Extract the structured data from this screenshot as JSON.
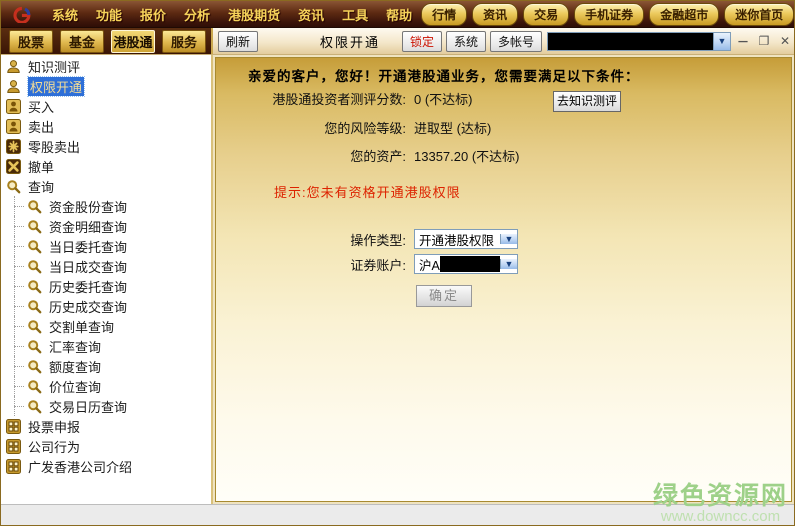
{
  "menubar": {
    "items": [
      "系统",
      "功能",
      "报价",
      "分析",
      "港股期货",
      "资讯",
      "工具",
      "帮助"
    ],
    "quick_links": [
      "行情",
      "资讯",
      "交易",
      "手机证券",
      "金融超市",
      "迷你首页"
    ],
    "controls": {
      "minimize": "－",
      "restore": "❐",
      "close": "✕"
    }
  },
  "tabs": {
    "items": [
      "股票",
      "基金",
      "港股通",
      "服务"
    ],
    "active": "港股通"
  },
  "toolbar": {
    "refresh": "刷新",
    "title": "权限开通",
    "lock": "锁定",
    "system": "系统",
    "multi_account": "多帐号",
    "account_combo_icon": "chevron-down-icon",
    "window_controls": {
      "minimize": "－",
      "restore": "❐",
      "close": "✕"
    }
  },
  "sidebar": {
    "items": [
      {
        "label": "知识测评",
        "icon": "person-icon"
      },
      {
        "label": "权限开通",
        "icon": "person-icon",
        "selected": true
      },
      {
        "label": "买入",
        "icon": "person-badge-icon"
      },
      {
        "label": "卖出",
        "icon": "person-badge-icon"
      },
      {
        "label": "零股卖出",
        "icon": "asterisk-icon"
      },
      {
        "label": "撤单",
        "icon": "x-mark-icon"
      },
      {
        "label": "查询",
        "icon": "magnifier-icon"
      },
      {
        "label": "资金股份查询",
        "icon": "magnifier-icon"
      },
      {
        "label": "资金明细查询",
        "icon": "magnifier-icon"
      },
      {
        "label": "当日委托查询",
        "icon": "magnifier-icon"
      },
      {
        "label": "当日成交查询",
        "icon": "magnifier-icon"
      },
      {
        "label": "历史委托查询",
        "icon": "magnifier-icon"
      },
      {
        "label": "历史成交查询",
        "icon": "magnifier-icon"
      },
      {
        "label": "交割单查询",
        "icon": "magnifier-icon"
      },
      {
        "label": "汇率查询",
        "icon": "magnifier-icon"
      },
      {
        "label": "额度查询",
        "icon": "magnifier-icon"
      },
      {
        "label": "价位查询",
        "icon": "magnifier-icon"
      },
      {
        "label": "交易日历查询",
        "icon": "magnifier-icon"
      },
      {
        "label": "投票申报",
        "icon": "grid-icon"
      },
      {
        "label": "公司行为",
        "icon": "grid-icon"
      },
      {
        "label": "广发香港公司介绍",
        "icon": "grid-icon"
      }
    ]
  },
  "main": {
    "greeting": "亲爱的客户，您好！开通港股通业务，您需要满足以下条件：",
    "conditions": [
      {
        "label": "港股通投资者测评分数:",
        "value": "0 (不达标)"
      },
      {
        "label": "您的风险等级:",
        "value": "进取型 (达标)"
      },
      {
        "label": "您的资产:",
        "value": "13357.20 (不达标)"
      }
    ],
    "quiz_button": "去知识测评",
    "tip": "提示:您未有资格开通港股权限",
    "form": {
      "operation_label": "操作类型:",
      "operation_value": "开通港股权限",
      "account_label": "证券账户:",
      "account_prefix": "沪A",
      "submit_label": "确定"
    }
  },
  "watermark": {
    "name": "绿色资源网",
    "url": "www.downcc.com"
  },
  "colors": {
    "accent_gold": "#d4a017",
    "menubar_dark": "#3c150a",
    "selection_blue": "#2e6fd8",
    "alert_red": "#dd2200",
    "watermark_green": "#9ed189"
  }
}
